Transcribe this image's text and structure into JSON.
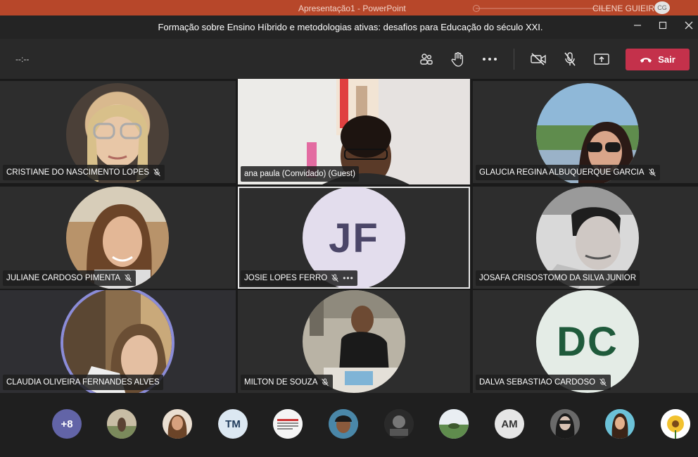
{
  "ppt": {
    "title": "Apresentação1 - PowerPoint",
    "user": "CILENE GUIEIRO",
    "user_initials": "CG"
  },
  "window": {
    "title": "Formação sobre Ensino Híbrido e metodologias ativas: desafios para Educação do século XXI."
  },
  "controls": {
    "timer": "--:--",
    "leave_label": "Sair",
    "icons": [
      "participants-icon",
      "raise-hand-icon",
      "more-icon",
      "camera-off-icon",
      "mic-off-icon",
      "share-icon"
    ]
  },
  "colors": {
    "leave": "#c4314b",
    "accent": "#8b8cd8"
  },
  "tiles": [
    {
      "name": "CRISTIANE DO NASCIMENTO LOPES",
      "muted": true,
      "kind": "photo"
    },
    {
      "name": "ana paula (Convidado) (Guest)",
      "muted": false,
      "kind": "video"
    },
    {
      "name": "GLAUCIA REGINA ALBUQUERQUE GARCIA",
      "muted": true,
      "kind": "photo"
    },
    {
      "name": "JULIANE CARDOSO PIMENTA",
      "muted": true,
      "kind": "photo"
    },
    {
      "name": "JOSIE LOPES FERRO",
      "muted": true,
      "kind": "initials",
      "initials": "JF",
      "more": "•••"
    },
    {
      "name": "JOSAFA CRISOSTOMO DA SILVA JUNIOR",
      "muted": false,
      "kind": "photo"
    },
    {
      "name": "CLAUDIA OLIVEIRA FERNANDES ALVES",
      "muted": false,
      "kind": "photo"
    },
    {
      "name": "MILTON DE SOUZA",
      "muted": true,
      "kind": "photo"
    },
    {
      "name": "DALVA SEBASTIAO CARDOSO",
      "muted": true,
      "kind": "initials",
      "initials": "DC"
    }
  ],
  "roster": {
    "overflow": "+8",
    "initials": [
      "TM",
      "AM"
    ]
  }
}
